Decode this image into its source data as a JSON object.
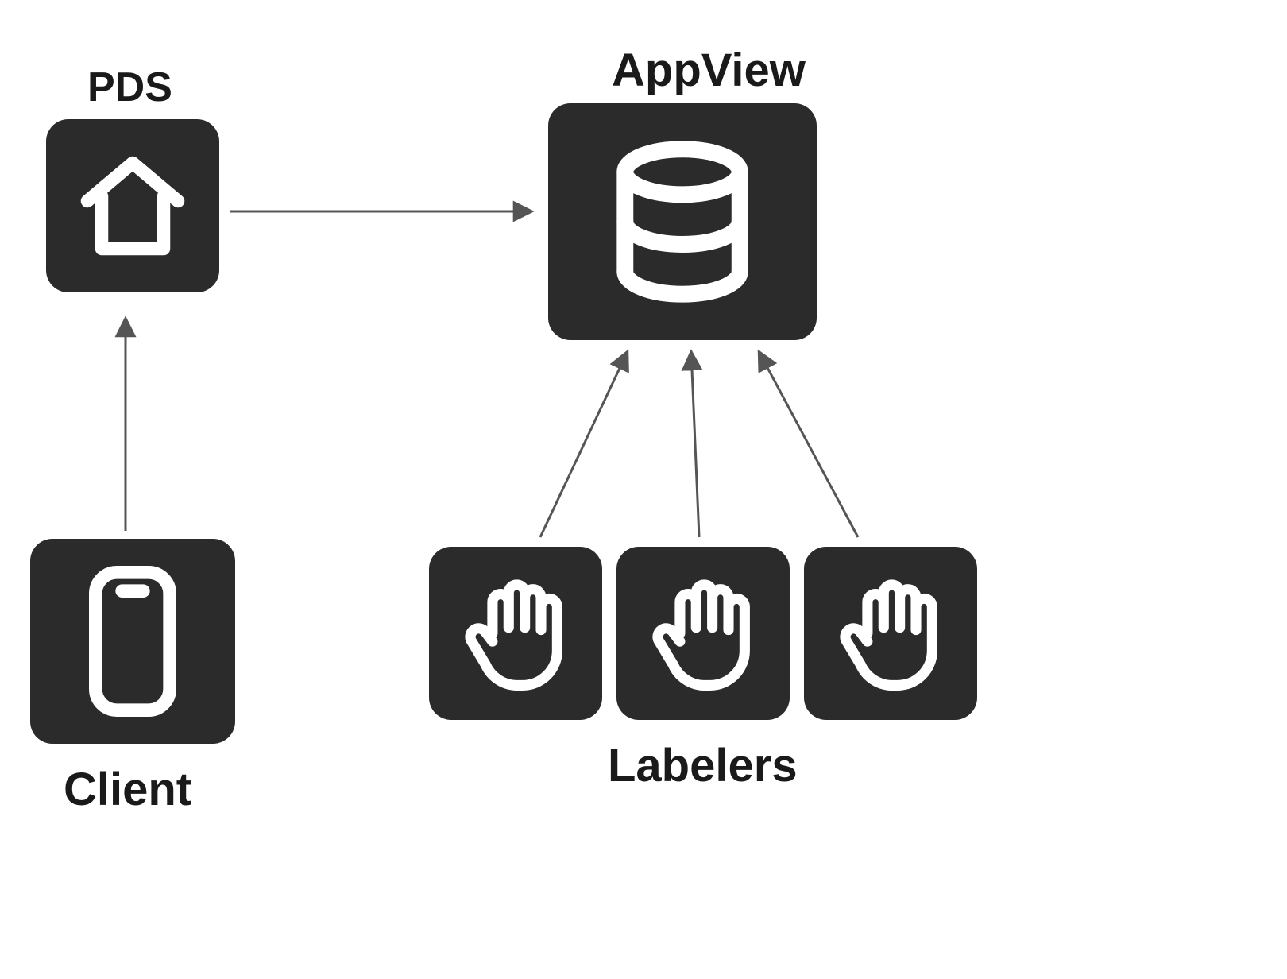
{
  "nodes": {
    "pds": {
      "label": "PDS",
      "icon": "home-icon"
    },
    "appview": {
      "label": "AppView",
      "icon": "database-icon"
    },
    "client": {
      "label": "Client",
      "icon": "phone-icon"
    },
    "labelers": {
      "label": "Labelers",
      "icon": "hand-icon",
      "count": 3
    }
  },
  "edges": [
    {
      "from": "client",
      "to": "pds"
    },
    {
      "from": "pds",
      "to": "appview"
    },
    {
      "from": "labelers[0]",
      "to": "appview"
    },
    {
      "from": "labelers[1]",
      "to": "appview"
    },
    {
      "from": "labelers[2]",
      "to": "appview"
    }
  ],
  "colors": {
    "boxFill": "#2b2b2b",
    "iconStroke": "#ffffff",
    "arrow": "#555555",
    "text": "#1a1a1a"
  }
}
